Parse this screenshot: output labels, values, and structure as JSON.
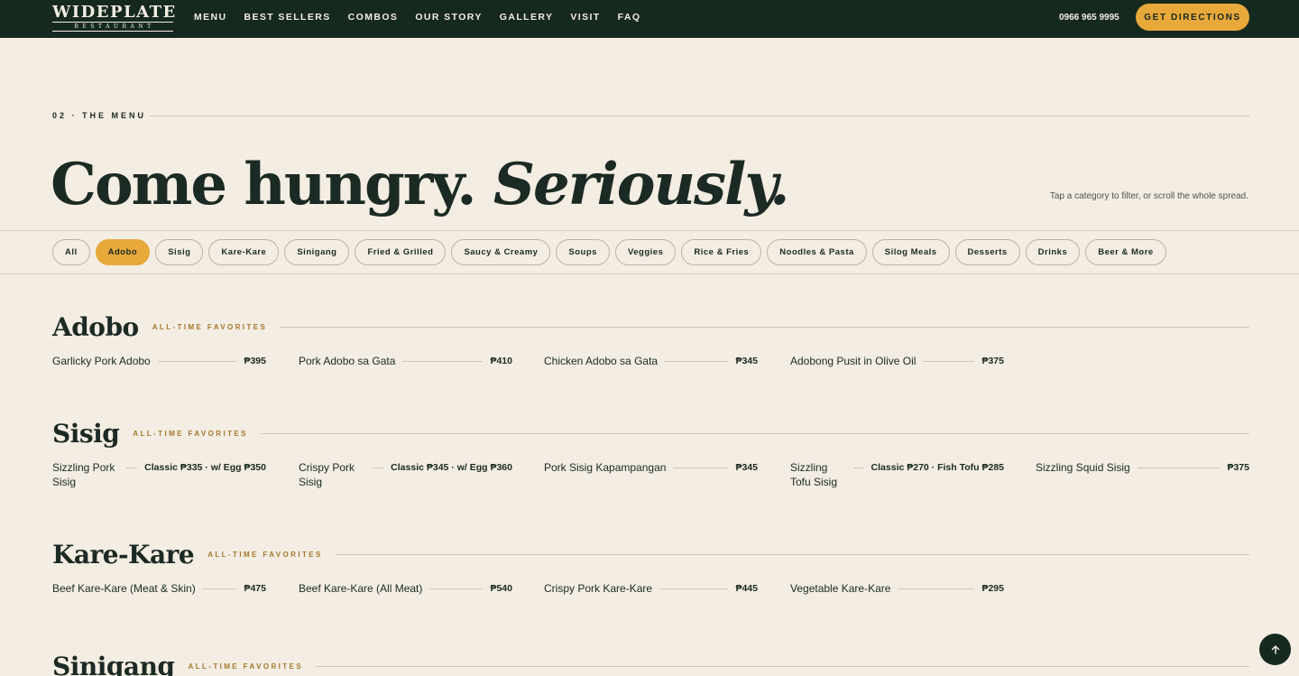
{
  "nav": {
    "logo_main": "WIDEPLATE",
    "logo_sub": "RESTAURANT",
    "links": [
      "MENU",
      "BEST SELLERS",
      "COMBOS",
      "OUR STORY",
      "GALLERY",
      "VISIT",
      "FAQ"
    ],
    "phone": "0966 965 9995",
    "cta": "GET DIRECTIONS"
  },
  "header": {
    "eyebrow": "02 · THE MENU",
    "headline_plain": "Come hungry.",
    "headline_italic": "Seriously.",
    "hint": "Tap a category to filter, or scroll the whole spread."
  },
  "filters": {
    "active": "Adobo",
    "chips": [
      "All",
      "Adobo",
      "Sisig",
      "Kare-Kare",
      "Sinigang",
      "Fried & Grilled",
      "Saucy & Creamy",
      "Soups",
      "Veggies",
      "Rice & Fries",
      "Noodles & Pasta",
      "Silog Meals",
      "Desserts",
      "Drinks",
      "Beer & More"
    ]
  },
  "categories": [
    {
      "title": "Adobo",
      "tag": "ALL-TIME FAVORITES",
      "items": [
        {
          "name": "Garlicky Pork Adobo",
          "price": "₱395"
        },
        {
          "name": "Pork Adobo sa Gata",
          "price": "₱410"
        },
        {
          "name": "Chicken Adobo sa Gata",
          "price": "₱345"
        },
        {
          "name": "Adobong Pusit in Olive Oil",
          "price": "₱375"
        }
      ]
    },
    {
      "title": "Sisig",
      "tag": "ALL-TIME FAVORITES",
      "items": [
        {
          "name": "Sizzling Pork Sisig",
          "price": "Classic ₱335 · w/ Egg ₱350"
        },
        {
          "name": "Crispy Pork Sisig",
          "price": "Classic ₱345 · w/ Egg ₱360"
        },
        {
          "name": "Pork Sisig Kapampangan",
          "price": "₱345"
        },
        {
          "name": "Sizzling Tofu Sisig",
          "price": "Classic ₱270 · Fish Tofu ₱285"
        },
        {
          "name": "Sizzling Squid Sisig",
          "price": "₱375"
        }
      ]
    },
    {
      "title": "Kare-Kare",
      "tag": "ALL-TIME FAVORITES",
      "items": [
        {
          "name": "Beef Kare-Kare (Meat & Skin)",
          "price": "₱475"
        },
        {
          "name": "Beef Kare-Kare (All Meat)",
          "price": "₱540"
        },
        {
          "name": "Crispy Pork Kare-Kare",
          "price": "₱445"
        },
        {
          "name": "Vegetable Kare-Kare",
          "price": "₱295"
        }
      ]
    },
    {
      "title": "Sinigang",
      "tag": "ALL-TIME FAVORITES",
      "items": []
    }
  ],
  "icons": {
    "back_to_top": "arrow-up-icon"
  },
  "colors": {
    "nav_bg": "#16291f",
    "accent": "#e8a83a",
    "page_bg": "#f3ede3",
    "tag": "#a5772b"
  }
}
